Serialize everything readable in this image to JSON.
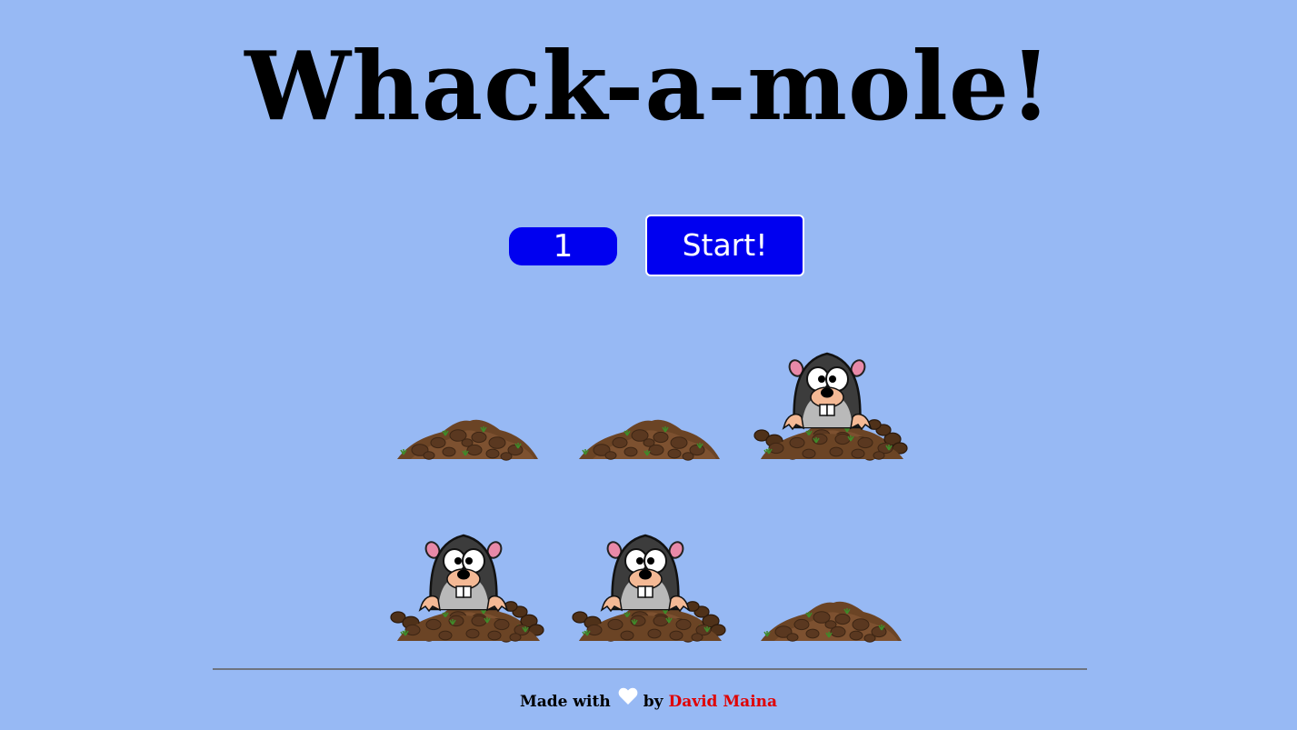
{
  "title": "Whack-a-mole!",
  "controls": {
    "score": "1",
    "start_label": "Start!"
  },
  "grid": {
    "holes": [
      {
        "mole_up": false
      },
      {
        "mole_up": false
      },
      {
        "mole_up": true
      },
      {
        "mole_up": true
      },
      {
        "mole_up": true
      },
      {
        "mole_up": false
      }
    ]
  },
  "footer": {
    "made_with": "Made with",
    "by": "by",
    "author": "David Maina",
    "heart_icon": "heart-icon"
  },
  "colors": {
    "background": "#97b9f4",
    "button": "#0000f0",
    "author_link": "#e00000"
  }
}
